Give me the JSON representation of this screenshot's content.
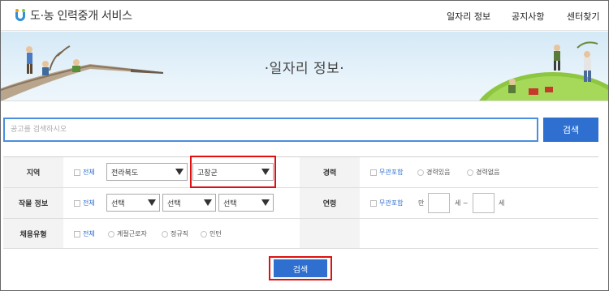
{
  "header": {
    "logo_text": "도·농 인력중개 서비스",
    "nav": [
      {
        "label": "일자리 정보"
      },
      {
        "label": "공지사항"
      },
      {
        "label": "센터찾기"
      }
    ]
  },
  "banner": {
    "title": "·일자리 정보·"
  },
  "search": {
    "placeholder": "공고를 검색하시오",
    "button_label": "검색"
  },
  "filters": {
    "region": {
      "label": "지역",
      "all_label": "전체",
      "province": "전라북도",
      "county": "고창군"
    },
    "crop": {
      "label": "작물 정보",
      "all_label": "전체",
      "selects": [
        "선택",
        "선택",
        "선택"
      ]
    },
    "employment_type": {
      "label": "채용유형",
      "all_label": "전체",
      "options": [
        "계절근로자",
        "정규직",
        "인턴"
      ]
    },
    "experience": {
      "label": "경력",
      "any_label": "무관포함",
      "options": [
        "경력있음",
        "경력없음"
      ]
    },
    "age": {
      "label": "연령",
      "any_label": "무관포함",
      "from_prefix": "만",
      "mid_text": "세 ~",
      "suffix": "세"
    }
  },
  "submit_label": "검색",
  "colors": {
    "primary_blue": "#2e6fd0",
    "highlight_red": "#e01010"
  }
}
